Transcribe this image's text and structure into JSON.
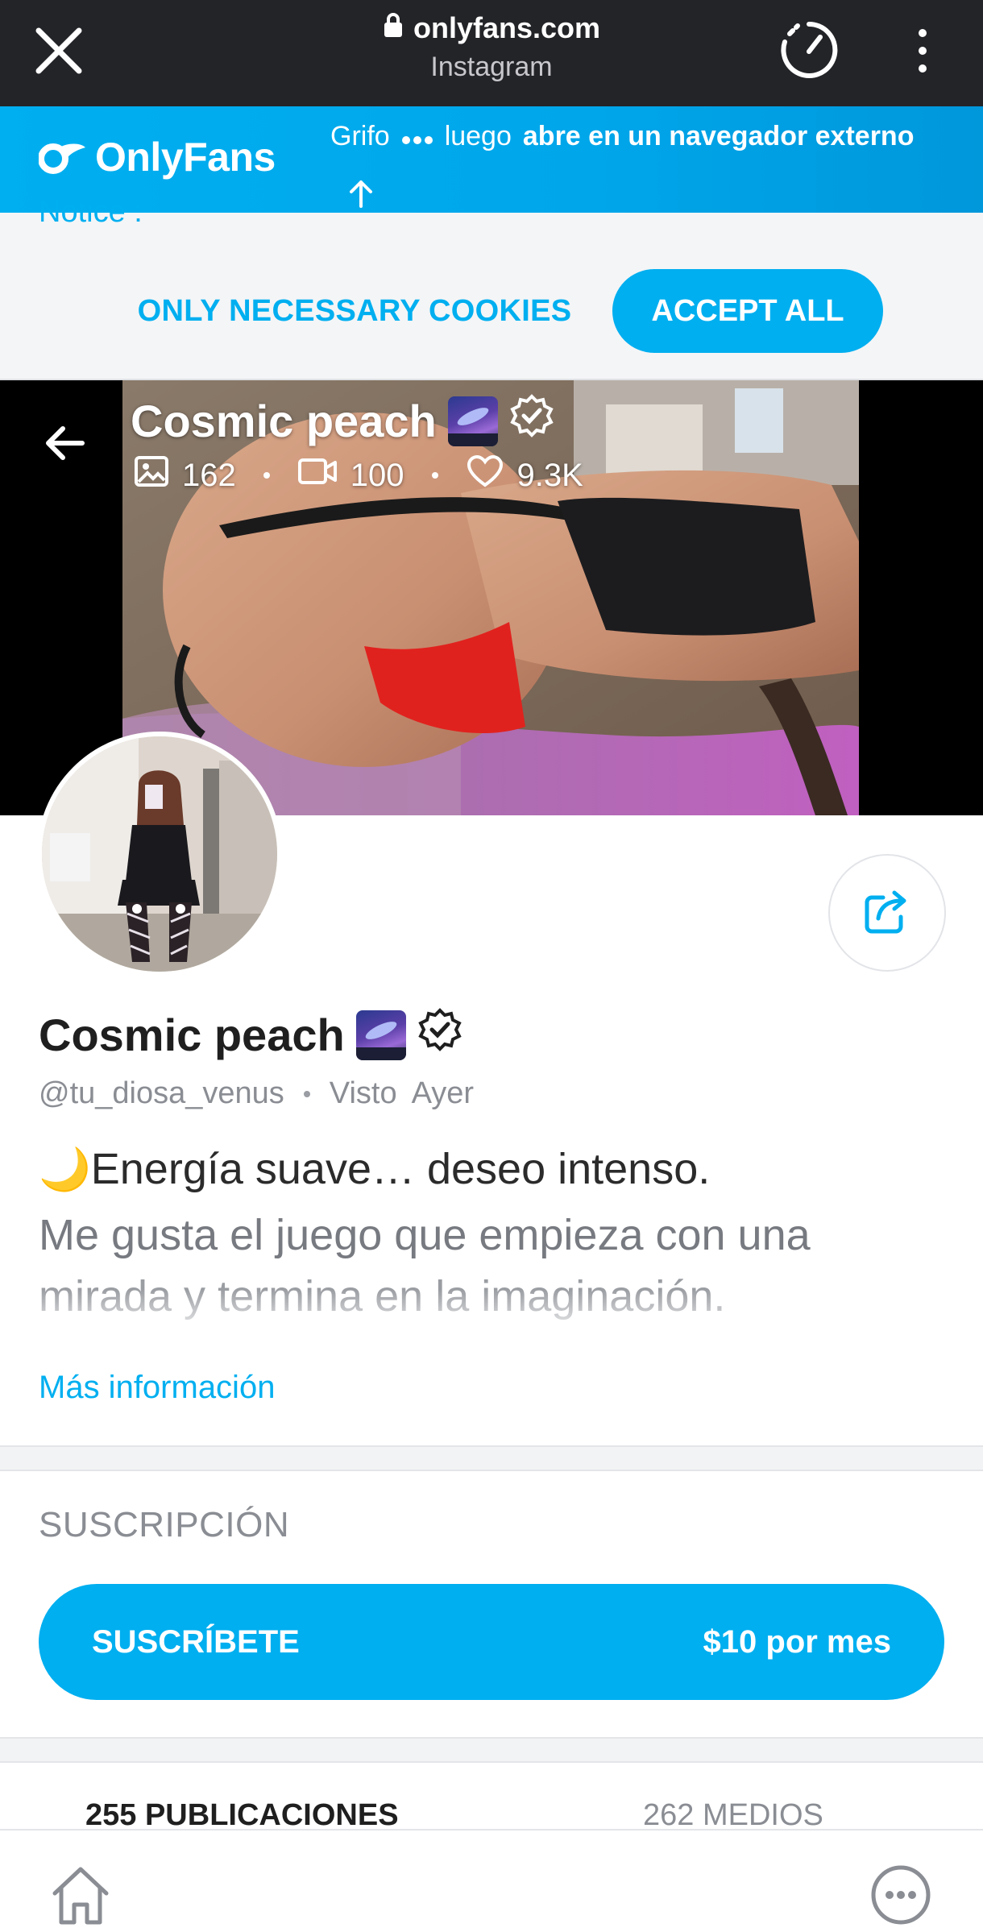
{
  "browser": {
    "domain": "onlyfans.com",
    "subtitle": "Instagram"
  },
  "banner": {
    "brand": "OnlyFans",
    "hint_prefix": "Grifo",
    "hint_middle": "luego",
    "hint_bold": "abre en un navegador externo"
  },
  "cookies": {
    "notice": "Notice :",
    "necessary_label": "ONLY NECESSARY COOKIES",
    "accept_label": "ACCEPT ALL"
  },
  "cover": {
    "name": "Cosmic peach",
    "photos": "162",
    "videos": "100",
    "likes": "9.3K"
  },
  "profile": {
    "name": "Cosmic peach",
    "handle": "@tu_diosa_venus",
    "seen_label": "Visto",
    "seen_value": "Ayer",
    "bio_emoji": "🌙",
    "bio_line1": "Energía suave… deseo intenso.",
    "bio_line2": "Me gusta el juego que empieza con una",
    "bio_line3": "mirada y termina en la imaginación.",
    "more_info": "Más información"
  },
  "subscription": {
    "title": "SUSCRIPCIÓN",
    "button_label": "SUSCRÍBETE",
    "price": "$10 por mes"
  },
  "tabs": {
    "posts": "255 PUBLICACIONES",
    "media": "262 MEDIOS"
  },
  "colors": {
    "brand_blue": "#00aff0",
    "browser_bar": "#232428"
  }
}
